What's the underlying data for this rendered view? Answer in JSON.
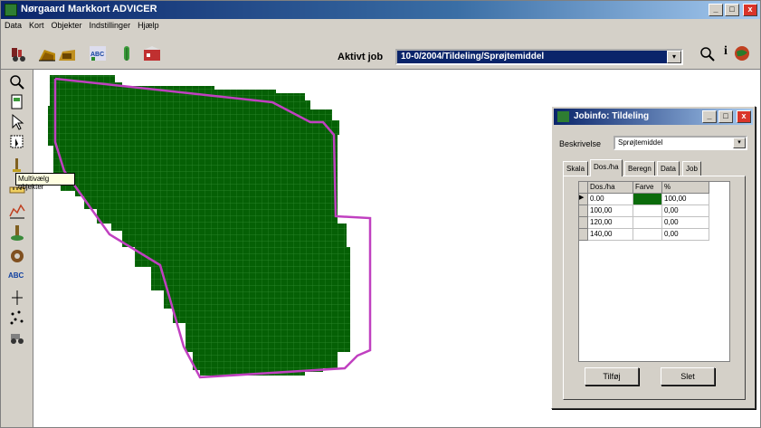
{
  "window": {
    "title": "Nørgaard Markkort ADVICER",
    "min_label": "_",
    "max_label": "□",
    "close_label": "x"
  },
  "menu": [
    "Data",
    "Kort",
    "Objekter",
    "Indstillinger",
    "Hjælp"
  ],
  "toolbar": {
    "icons": [
      "tractor-icon",
      "field-1-icon",
      "field-2-icon",
      "abc-icon",
      "plant-icon",
      "map-icon"
    ],
    "job_label": "Aktivt job",
    "job_value": "10-0/2004/Tildeling/Sprøjtemiddel",
    "dropdown_arrow": "▾",
    "right_icons": [
      "search-icon",
      "info-icon",
      "globe-icon"
    ],
    "info_text": "i"
  },
  "left_tools": [
    "zoom-icon",
    "page-icon",
    "pointer-icon",
    "select-icon",
    "multiselect-icon",
    "ruler-icon",
    "chart-icon",
    "sampler-icon",
    "gear-icon",
    "abc-icon",
    "line-icon",
    "scatter-icon",
    "tractor-icon"
  ],
  "tooltip": "Multivælg objekter",
  "map": {
    "field_color": "#056005",
    "grid_line_color": "#2f8a2f",
    "outline_color": "#c040c0"
  },
  "dialog": {
    "title": "Jobinfo: Tildeling",
    "min_label": "_",
    "max_label": "□",
    "close_label": "x",
    "beskrivelse_label": "Beskrivelse",
    "beskrivelse_value": "Sprøjtemiddel",
    "tabs": [
      "Skala",
      "Dos./ha",
      "Beregn",
      "Data",
      "Job"
    ],
    "active_tab": "Dos./ha",
    "columns": [
      "Dos./ha",
      "Farve",
      "%"
    ],
    "rows": [
      {
        "dose": "0.00",
        "color": "#0b6b0b",
        "pct": "100,00"
      },
      {
        "dose": "100,00",
        "color": "",
        "pct": "0,00"
      },
      {
        "dose": "120,00",
        "color": "",
        "pct": "0,00"
      },
      {
        "dose": "140,00",
        "color": "",
        "pct": "0,00"
      }
    ],
    "add_button": "Tilføj",
    "delete_button": "Slet"
  }
}
